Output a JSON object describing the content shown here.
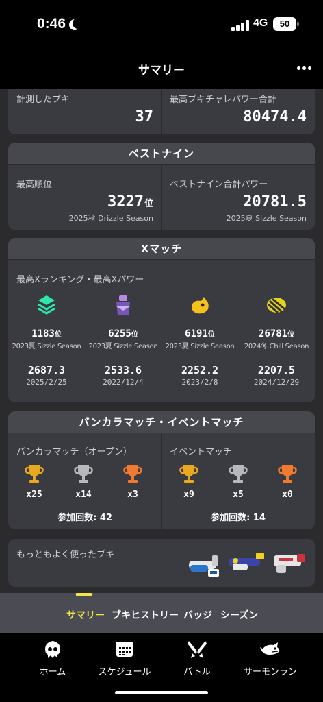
{
  "status_bar": {
    "time": "0:46",
    "network": "4G",
    "battery": "50"
  },
  "header": {
    "title": "サマリー",
    "more_icon": "ellipsis-icon"
  },
  "weapons_card": {
    "measured_label": "計測したブキ",
    "measured_value": "37",
    "max_power_label": "最高ブキチャレパワー合計",
    "max_power_value": "80474.4"
  },
  "best_nine": {
    "title": "ベストナイン",
    "rank_label": "最高順位",
    "rank_value": "3227",
    "rank_unit": "位",
    "rank_season": "2025秋 Drizzle Season",
    "power_label": "ベストナイン合計パワー",
    "power_value": "20781.5",
    "power_season": "2025夏 Sizzle Season"
  },
  "x_match": {
    "title": "Xマッチ",
    "subtitle": "最高Xランキング・最高Xパワー",
    "modes": [
      {
        "icon": "splat-zones-icon",
        "rank": "1183",
        "unit": "位",
        "season": "2023夏 Sizzle Season",
        "power": "2687.3",
        "date": "2025/2/25"
      },
      {
        "icon": "tower-control-icon",
        "rank": "6255",
        "unit": "位",
        "season": "2023夏 Sizzle Season",
        "power": "2533.6",
        "date": "2022/12/4"
      },
      {
        "icon": "rainmaker-icon",
        "rank": "6191",
        "unit": "位",
        "season": "2023夏 Sizzle Season",
        "power": "2252.2",
        "date": "2023/2/8"
      },
      {
        "icon": "clam-blitz-icon",
        "rank": "26781",
        "unit": "位",
        "season": "2024冬 Chill Season",
        "power": "2207.5",
        "date": "2024/12/29"
      }
    ]
  },
  "bankara_event": {
    "title": "バンカラマッチ・イベントマッチ",
    "bankara": {
      "label": "バンカラマッチ（オープン）",
      "gold": "x25",
      "silver": "x14",
      "bronze": "x3",
      "participation": "参加回数: 42"
    },
    "event": {
      "label": "イベントマッチ",
      "gold": "x9",
      "silver": "x5",
      "bronze": "x0",
      "participation": "参加回数: 14"
    }
  },
  "most_used": {
    "label": "もっともよく使ったブキ"
  },
  "tabs": [
    "サマリー",
    "ブキヒストリー",
    "バッジ",
    "シーズン"
  ],
  "bottom_nav": [
    {
      "label": "ホーム",
      "icon": "squid-icon"
    },
    {
      "label": "スケジュール",
      "icon": "calendar-icon"
    },
    {
      "label": "バトル",
      "icon": "battle-icon"
    },
    {
      "label": "サーモンラン",
      "icon": "salmon-icon"
    }
  ],
  "colors": {
    "accent": "#f2e44a",
    "gold": "#e9a820",
    "silver": "#b8b8bc",
    "bronze": "#f07a30",
    "card": "#3a3b40"
  }
}
